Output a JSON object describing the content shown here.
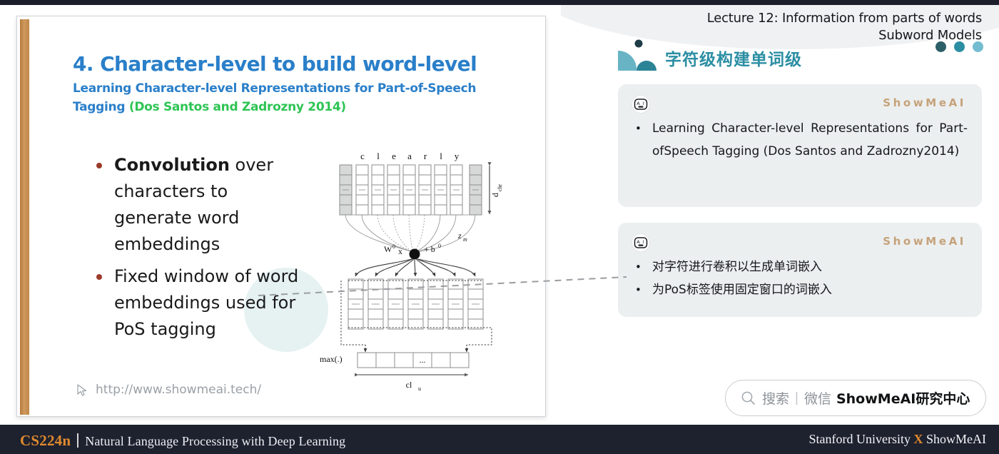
{
  "topbar": {
    "label": "window-chrome"
  },
  "slide": {
    "title_main": "4. Character-level to build word-level",
    "title_sub": "Learning Character-level Representations for Part-of-Speech Tagging ",
    "title_cite": "(Dos Santos and Zadrozny 2014)",
    "bullets": [
      {
        "lead": "Convolution",
        "rest": " over characters to generate word embeddings"
      },
      {
        "lead": "",
        "rest": "Fixed window of word embeddings used for PoS tagging"
      }
    ],
    "url": "http://www.showmeai.tech/",
    "cursor_icon": "cursor-arrow-icon"
  },
  "diagram": {
    "word_chars": [
      "c",
      "l",
      "e",
      "a",
      "r",
      "l",
      "y"
    ],
    "embed_dim_label": "d",
    "embed_dim_sup": "chr",
    "z_label": "z",
    "z_sub": "m",
    "formula_w": "W",
    "formula_w_sup": "0",
    "formula_x": "x",
    "formula_plus": "+ b",
    "formula_b_sup": "0",
    "max_label": "max(.)",
    "cl_label": "cl",
    "cl_sub": "u",
    "ellipsis": "...",
    "n_input_columns": 9,
    "n_conv_columns": 7,
    "n_pool_cells": 6
  },
  "right_panel": {
    "lecture_line1": "Lecture 12: Information from parts of words",
    "lecture_line2": "Subword Models",
    "dots": [
      "#2d5f68",
      "#2b8ea3",
      "#74bcd0"
    ],
    "logo": {
      "name": "showmeai-logo",
      "big_color": "#69b4c4",
      "small_color": "#2b8396",
      "dot_color": "#1f3d46"
    },
    "cn_heading": "字符级构建单词级",
    "cards": [
      {
        "badge": "ai-robot-icon",
        "badge_text": "A I",
        "brand": "ShowMeAI",
        "items": [
          "Learning Character-level Representations for Part-ofSpeech Tagging (Dos Santos and Zadrozny2014)"
        ]
      },
      {
        "badge": "ai-robot-icon",
        "badge_text": "A I",
        "brand": "ShowMeAI",
        "items": [
          "对字符进行卷积以生成单词嵌入",
          "为PoS标签使用固定窗口的词嵌入"
        ]
      }
    ],
    "search": {
      "icon": "search-icon",
      "placeholder": "搜索",
      "separator": "|",
      "channel": "微信",
      "brand": "ShowMeAI研究中心"
    }
  },
  "footer": {
    "course_code": "CS224n",
    "course_name": "Natural Language Processing with Deep Learning",
    "right_left": "Stanford University ",
    "right_x": "X",
    "right_right": " ShowMeAI"
  },
  "colors": {
    "accent_blue": "#2a7fc9",
    "accent_green": "#2ec454",
    "teal": "#2b8ea3",
    "bronze": "#c08648",
    "orange": "#e08a2e",
    "card_bg": "#eceff0",
    "brand_gold": "#c5a27a"
  }
}
